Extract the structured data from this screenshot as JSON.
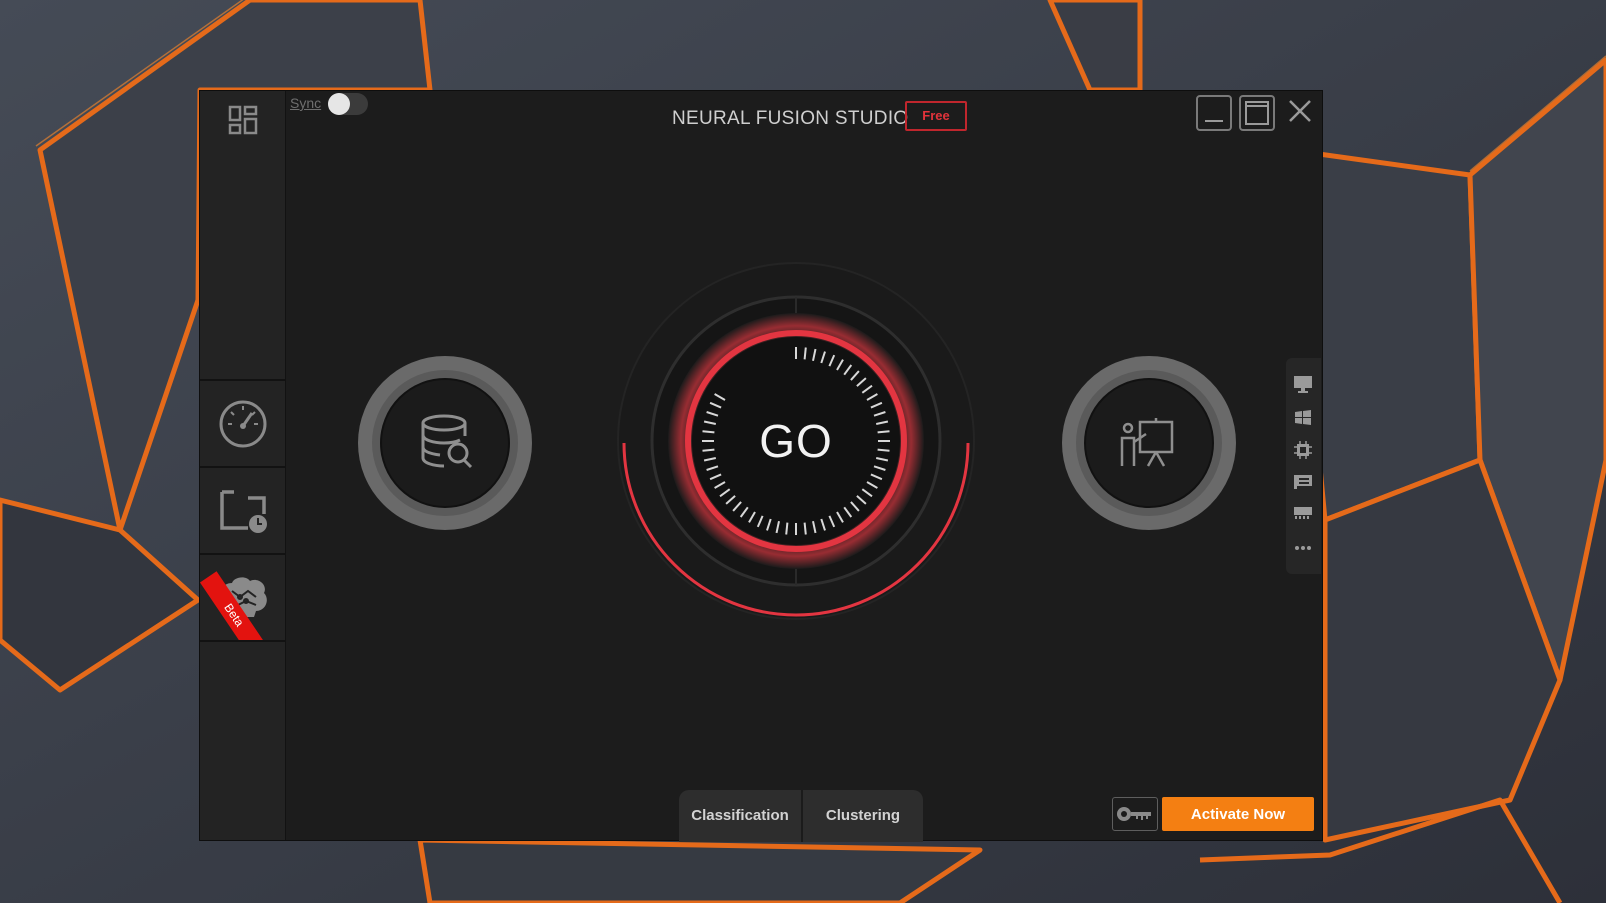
{
  "window": {
    "title": "NEURAL FUSION STUDIO",
    "plan_badge": "Free",
    "sync_label": "Sync",
    "sync_on": false
  },
  "sidebar": {
    "items": [
      {
        "icon": "dashboard-grid-icon"
      },
      {
        "icon": "speedometer-icon"
      },
      {
        "icon": "scheduled-folder-icon"
      },
      {
        "icon": "brain-icon",
        "badge": "Beta"
      }
    ]
  },
  "main": {
    "go_label": "GO",
    "left_node_icon": "database-search-icon",
    "right_node_icon": "presentation-icon"
  },
  "device_panel": {
    "icons": [
      "monitor-icon",
      "windows-icon",
      "cpu-icon",
      "gpu-card-icon",
      "memory-icon",
      "more-icon"
    ]
  },
  "tabs": [
    {
      "label": "Classification"
    },
    {
      "label": "Clustering"
    }
  ],
  "footer": {
    "activate_label": "Activate Now",
    "key_icon": "license-key-icon"
  },
  "colors": {
    "accent_red": "#e33541",
    "activate_orange": "#f47f12",
    "badge_red": "#c0262d",
    "window_bg": "#1c1c1c",
    "wallpaper_edge": "#e56a1a"
  }
}
